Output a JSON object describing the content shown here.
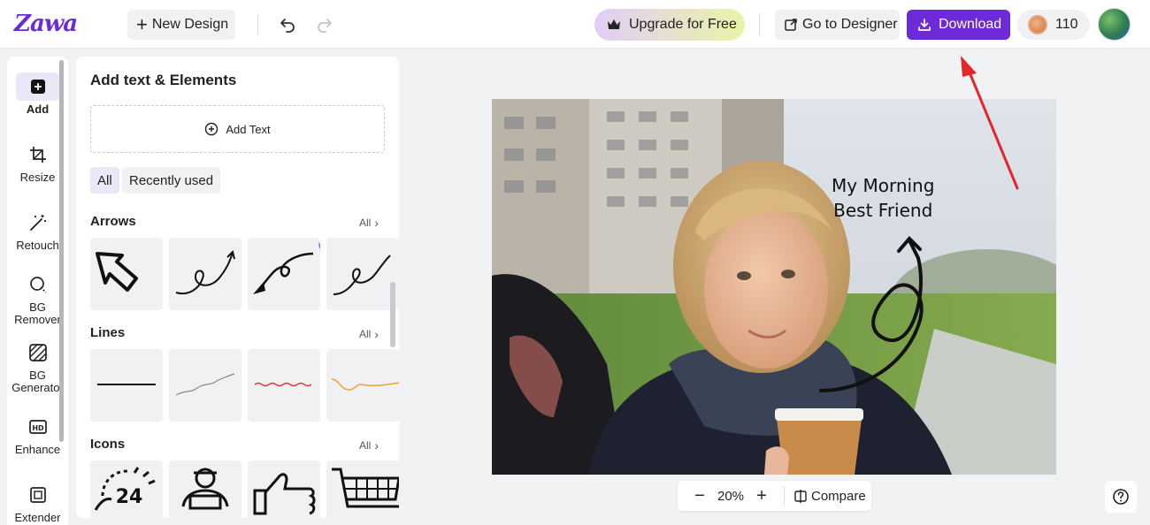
{
  "header": {
    "logo": "Zawa",
    "new_design_label": "New Design",
    "upgrade_label": "Upgrade for Free",
    "designer_label": "Go to Designer",
    "download_label": "Download",
    "credits": "110"
  },
  "rail": {
    "add": "Add",
    "resize": "Resize",
    "retouch": "Retouch",
    "bg_remover_1": "BG",
    "bg_remover_2": "Remover",
    "bg_generator_1": "BG",
    "bg_generator_2": "Generator",
    "enhance": "Enhance",
    "extender": "Extender"
  },
  "panel": {
    "title": "Add text & Elements",
    "add_text_label": "Add Text",
    "filters": [
      "All",
      "Recently used"
    ],
    "sections": [
      {
        "title": "Arrows",
        "all_label": "All"
      },
      {
        "title": "Lines",
        "all_label": "All"
      },
      {
        "title": "Icons",
        "all_label": "All"
      }
    ],
    "icon_tile_number": "24"
  },
  "canvas": {
    "text_line_1": "My Morning",
    "text_line_2": "Best Friend"
  },
  "zoom": {
    "value": "20%",
    "compare_label": "Compare"
  },
  "colors": {
    "brand": "#6c2ad8",
    "annotation_arrow": "#e3262b"
  }
}
